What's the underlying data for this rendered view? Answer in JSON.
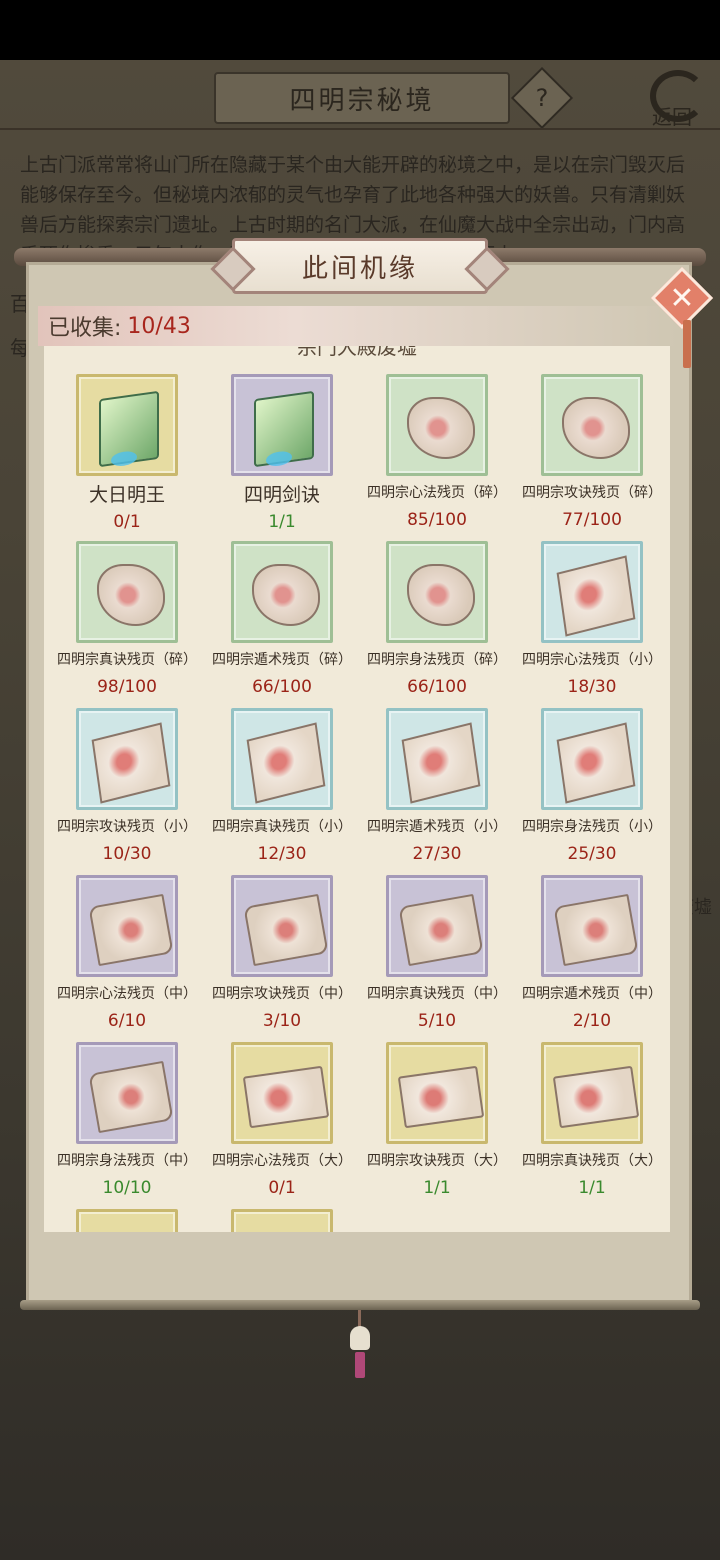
{
  "background": {
    "title": "四明宗秘境",
    "help_label": "?",
    "back_label": "返回",
    "description": "上古门派常常将山门所在隐藏于某个由大能开辟的秘境之中，是以在宗门毁灭后能够保存至今。但秘境内浓郁的灵气也孕育了此地各种强大的妖兽。只有清剿妖兽后方能探索宗门遗址。上古时期的名门大派，在仙魔大战中全宗出动，门内高手死伤惨重，元气大伤，剩余门人弟子多投奔其它仙宗而去。",
    "side_left": [
      "百",
      "每"
    ],
    "side_right": "废墟"
  },
  "panel": {
    "title": "此间机缘",
    "close_label": "✕",
    "collected_label": "已收集:",
    "collected_count": "10/43",
    "section_header_cut": "宗门大殿废墟"
  },
  "items": [
    {
      "name": "大日明王",
      "count": "0/1",
      "frame": "gold",
      "icon": "book",
      "big": true,
      "done": false
    },
    {
      "name": "四明剑诀",
      "count": "1/1",
      "frame": "purple",
      "icon": "book",
      "big": true,
      "done": true
    },
    {
      "name": "四明宗心法残页（碎）",
      "count": "85/100",
      "frame": "green",
      "icon": "scrap",
      "done": false
    },
    {
      "name": "四明宗攻诀残页（碎）",
      "count": "77/100",
      "frame": "green",
      "icon": "scrap",
      "done": false
    },
    {
      "name": "四明宗真诀残页（碎）",
      "count": "98/100",
      "frame": "green",
      "icon": "scrap",
      "done": false
    },
    {
      "name": "四明宗遁术残页（碎）",
      "count": "66/100",
      "frame": "green",
      "icon": "scrap",
      "done": false
    },
    {
      "name": "四明宗身法残页（碎）",
      "count": "66/100",
      "frame": "green",
      "icon": "scrap",
      "done": false
    },
    {
      "name": "四明宗心法残页（小）",
      "count": "18/30",
      "frame": "teal",
      "icon": "page",
      "done": false
    },
    {
      "name": "四明宗攻诀残页（小）",
      "count": "10/30",
      "frame": "teal",
      "icon": "page",
      "done": false
    },
    {
      "name": "四明宗真诀残页（小）",
      "count": "12/30",
      "frame": "teal",
      "icon": "page",
      "done": false
    },
    {
      "name": "四明宗遁术残页（小）",
      "count": "27/30",
      "frame": "teal",
      "icon": "page",
      "done": false
    },
    {
      "name": "四明宗身法残页（小）",
      "count": "25/30",
      "frame": "teal",
      "icon": "page",
      "done": false
    },
    {
      "name": "四明宗心法残页（中）",
      "count": "6/10",
      "frame": "purple",
      "icon": "roll",
      "done": false
    },
    {
      "name": "四明宗攻诀残页（中）",
      "count": "3/10",
      "frame": "purple",
      "icon": "roll",
      "done": false
    },
    {
      "name": "四明宗真诀残页（中）",
      "count": "5/10",
      "frame": "purple",
      "icon": "roll",
      "done": false
    },
    {
      "name": "四明宗遁术残页（中）",
      "count": "2/10",
      "frame": "purple",
      "icon": "roll",
      "done": false
    },
    {
      "name": "四明宗身法残页（中）",
      "count": "10/10",
      "frame": "purple",
      "icon": "roll",
      "done": true
    },
    {
      "name": "四明宗心法残页（大）",
      "count": "0/1",
      "frame": "gold",
      "icon": "wide",
      "done": false
    },
    {
      "name": "四明宗攻诀残页（大）",
      "count": "1/1",
      "frame": "gold",
      "icon": "wide",
      "done": true
    },
    {
      "name": "四明宗真诀残页（大）",
      "count": "1/1",
      "frame": "gold",
      "icon": "wide",
      "done": true
    },
    {
      "name": "",
      "count": "",
      "frame": "gold",
      "icon": "none",
      "done": false
    },
    {
      "name": "",
      "count": "",
      "frame": "gold",
      "icon": "none",
      "done": false
    }
  ]
}
